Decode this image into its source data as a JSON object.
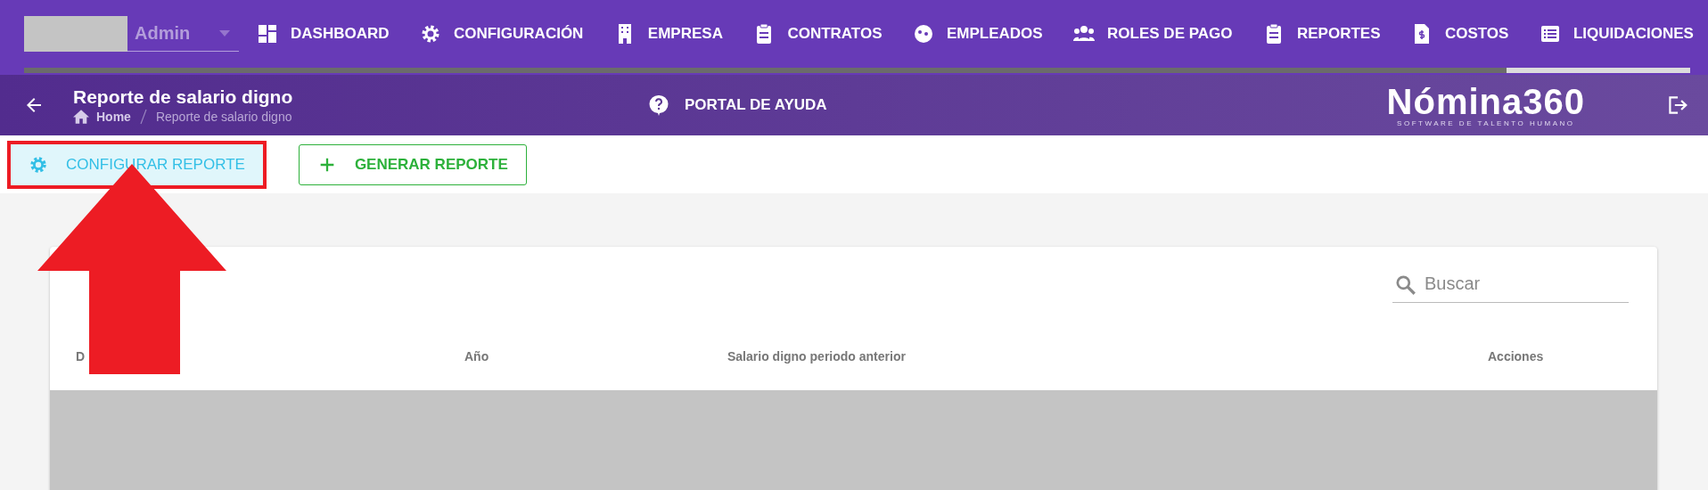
{
  "topbar": {
    "user_field": {
      "value": "Admin"
    },
    "nav": [
      {
        "label": "DASHBOARD"
      },
      {
        "label": "CONFIGURACIÓN"
      },
      {
        "label": "EMPRESA"
      },
      {
        "label": "CONTRATOS"
      },
      {
        "label": "EMPLEADOS"
      },
      {
        "label": "ROLES DE PAGO"
      },
      {
        "label": "REPORTES"
      },
      {
        "label": "COSTOS"
      },
      {
        "label": "LIQUIDACIONES"
      }
    ],
    "progress": {
      "level": 0.89
    }
  },
  "header": {
    "title": "Reporte de salario digno",
    "breadcrumb": [
      "Home",
      "Reporte de salario digno"
    ],
    "help": "PORTAL DE AYUDA",
    "logo": {
      "name": "Nómina360",
      "tagline": "SOFTWARE DE TALENTO HUMANO"
    }
  },
  "toolbar": {
    "buttons": [
      {
        "label": "CONFIGURAR REPORTE",
        "kind": "configure",
        "highlighted": true
      },
      {
        "label": "GENERAR REPORTE",
        "kind": "generate",
        "highlighted": false
      }
    ]
  },
  "table": {
    "search": {
      "placeholder": "Buscar"
    },
    "columns": [
      "D",
      "Año",
      "Salario digno periodo anterior",
      "Acciones"
    ]
  }
}
